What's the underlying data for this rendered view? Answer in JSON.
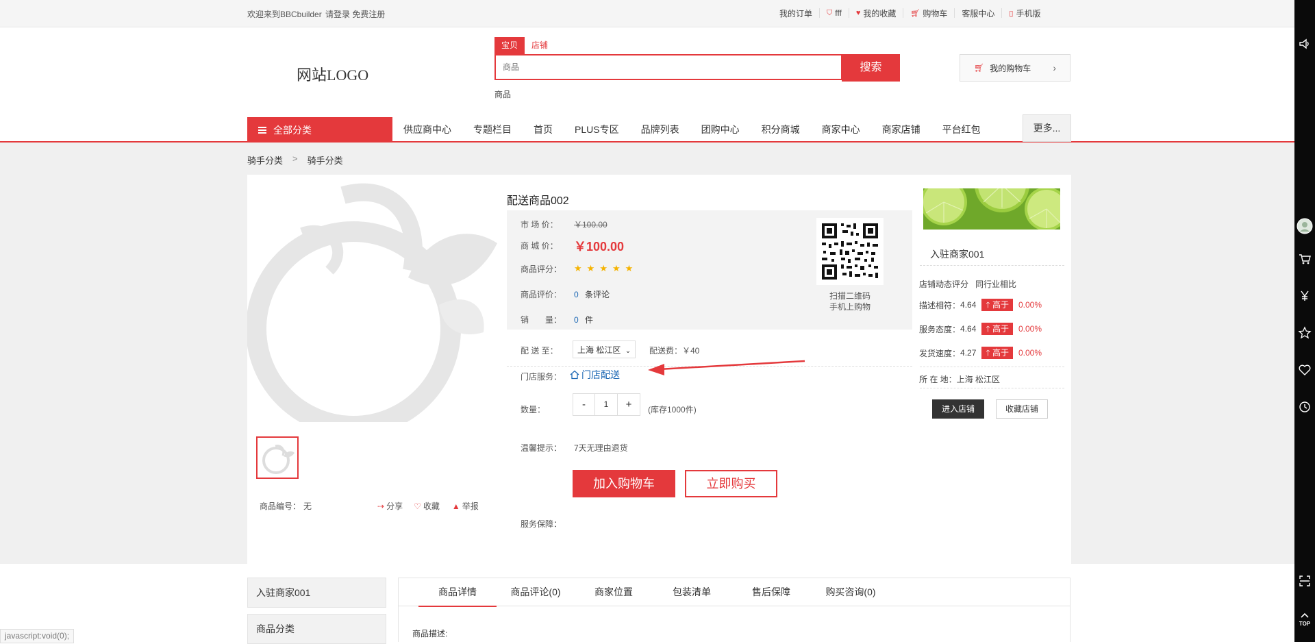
{
  "topbar": {
    "welcome": "欢迎来到BBCbuilder",
    "login": "请登录",
    "register": "免费注册",
    "links": [
      "我的订单",
      "fff",
      "我的收藏",
      "购物车",
      "客服中心",
      "手机版"
    ]
  },
  "header": {
    "logo": "网站LOGO",
    "search_tabs": [
      "宝贝",
      "店铺"
    ],
    "search_placeholder": "商品",
    "search_button": "搜索",
    "hot_word": "商品",
    "cart_label": "我的购物车"
  },
  "nav": {
    "all_categories": "全部分类",
    "items": [
      "供应商中心",
      "专题栏目",
      "首页",
      "PLUS专区",
      "品牌列表",
      "团购中心",
      "积分商城",
      "商家中心",
      "商家店铺",
      "平台红包"
    ],
    "more": "更多..."
  },
  "breadcrumb": [
    "骑手分类",
    ">",
    "骑手分类"
  ],
  "product": {
    "title": "配送商品002",
    "market_price_label": "市 场 价：",
    "market_price": "￥100.00",
    "mall_price_label": "商 城 价：",
    "mall_price": "￥100.00",
    "rating_label": "商品评分：",
    "rating_stars": 5,
    "review_label": "商品评价：",
    "review_count": "0",
    "review_suffix": "条评论",
    "sales_label": "销　　量：",
    "sales_count": "0",
    "sales_unit": "件",
    "qr_text_1": "扫描二维码",
    "qr_text_2": "手机上购物",
    "ship_label": "配 送 至：",
    "ship_region": "上海 松江区",
    "ship_fee": "配送费：￥40",
    "store_service_label": "门店服务：",
    "store_service": "门店配送",
    "qty_label": "数量：",
    "qty_minus": "-",
    "qty_value": "1",
    "qty_plus": "+",
    "stock": "(库存1000件)",
    "tip_label": "温馨提示：",
    "tip": "7天无理由退货",
    "add_cart": "加入购物车",
    "buy_now": "立即购买",
    "guarantee_label": "服务保障：",
    "code_label": "商品编号：",
    "code_value": "无",
    "share": "分享",
    "favorite": "收藏",
    "report": "举报"
  },
  "store": {
    "name": "入驻商家001",
    "dyn_label": "店铺动态评分",
    "compare_label": "同行业相比",
    "ratings": [
      {
        "label": "描述相符：",
        "score": "4.64",
        "tag": "高于",
        "pct": "0.00%"
      },
      {
        "label": "服务态度：",
        "score": "4.64",
        "tag": "高于",
        "pct": "0.00%"
      },
      {
        "label": "发货速度：",
        "score": "4.27",
        "tag": "高于",
        "pct": "0.00%"
      }
    ],
    "location": "所 在 地：上海 松江区",
    "enter": "进入店铺",
    "collect": "收藏店铺"
  },
  "lower": {
    "side": [
      "入驻商家001",
      "商品分类"
    ],
    "tabs": [
      "商品详情",
      "商品评论(0)",
      "商家位置",
      "包装清单",
      "售后保障",
      "购买咨询(0)"
    ],
    "desc_label": "商品描述:",
    "status_url": "javascript:void(0);"
  },
  "colors": {
    "accent": "#e4393c",
    "link": "#1a66b3",
    "star": "#f5b301"
  }
}
